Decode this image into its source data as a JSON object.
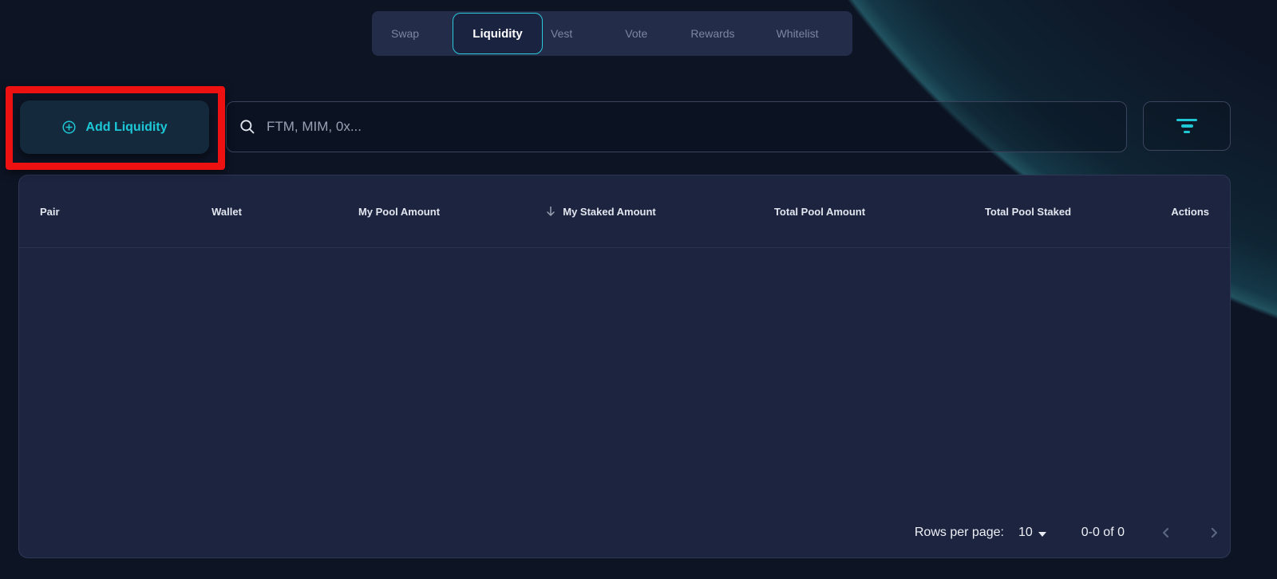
{
  "tabs": {
    "items": [
      {
        "label": "Swap",
        "active": false
      },
      {
        "label": "Liquidity",
        "active": true
      },
      {
        "label": "Vest",
        "active": false
      },
      {
        "label": "Vote",
        "active": false
      },
      {
        "label": "Rewards",
        "active": false
      },
      {
        "label": "Whitelist",
        "active": false
      }
    ],
    "active_tab": "Liquidity"
  },
  "toolbar": {
    "add_liquidity": {
      "label": "Add Liquidity",
      "icon": "plus-circle-icon"
    },
    "search": {
      "placeholder": "FTM, MIM, 0x...",
      "value": "",
      "icon": "search-icon"
    },
    "filter": {
      "icon": "filter-icon"
    }
  },
  "table": {
    "columns": [
      {
        "label": "Pair"
      },
      {
        "label": "Wallet"
      },
      {
        "label": "My Pool Amount"
      },
      {
        "label": "My Staked Amount",
        "sorted": "desc",
        "sort_icon": "arrow-down-icon"
      },
      {
        "label": "Total Pool Amount"
      },
      {
        "label": "Total Pool Staked"
      },
      {
        "label": "Actions"
      }
    ],
    "rows": []
  },
  "pagination": {
    "rows_per_page_label": "Rows per page:",
    "rows_per_page_value": "10",
    "range": "0-0 of 0",
    "prev_icon": "chevron-left-icon",
    "next_icon": "chevron-right-icon"
  },
  "annotation": {
    "type": "highlight-box",
    "target": "add-liquidity-button",
    "color": "#ee1111"
  },
  "colors": {
    "accent": "#1fc7d4",
    "annotation_red": "#ee1111",
    "page_bg": "#0d1424",
    "panel_bg": "#1c2440",
    "tabbar_bg": "#232d4a"
  }
}
